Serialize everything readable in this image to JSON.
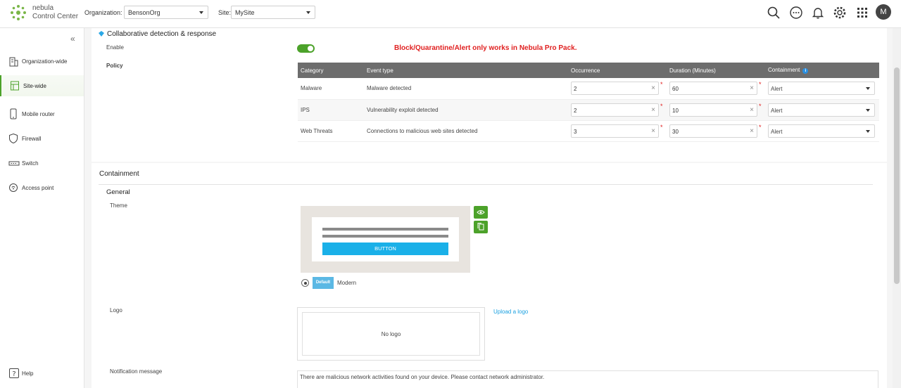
{
  "header": {
    "brand_line1": "nebula",
    "brand_line2": "Control Center",
    "org_label": "Organization:",
    "org_value": "BensonOrg",
    "site_label": "Site:",
    "site_value": "MySite",
    "avatar_letter": "M"
  },
  "sidebar": {
    "items": [
      {
        "label": "Organization-wide"
      },
      {
        "label": "Site-wide"
      },
      {
        "label": "Mobile router"
      },
      {
        "label": "Firewall"
      },
      {
        "label": "Switch"
      },
      {
        "label": "Access point"
      }
    ],
    "help": "Help"
  },
  "cdr": {
    "title": "Collaborative detection & response",
    "enable_label": "Enable",
    "policy_label": "Policy",
    "warning": "Block/Quarantine/Alert only works in Nebula Pro Pack.",
    "columns": [
      "Category",
      "Event type",
      "Occurrence",
      "Duration (Minutes)",
      "Containment"
    ],
    "rows": [
      {
        "category": "Malware",
        "event": "Malware detected",
        "occurrence": "2",
        "duration": "60",
        "containment": "Alert"
      },
      {
        "category": "IPS",
        "event": "Vulnerability exploit detected",
        "occurrence": "2",
        "duration": "10",
        "containment": "Alert"
      },
      {
        "category": "Web Threats",
        "event": "Connections to malicious web sites detected",
        "occurrence": "3",
        "duration": "30",
        "containment": "Alert"
      }
    ]
  },
  "containment": {
    "title": "Containment",
    "general": "General",
    "theme_label": "Theme",
    "preview_button": "BUTTON",
    "default_badge": "Default",
    "theme_name": "Modern",
    "logo_label": "Logo",
    "no_logo": "No logo",
    "upload_link": "Upload a logo",
    "notification_label": "Notification message",
    "notification_text": "There are malicious network activities found on your device. Please contact network administrator."
  },
  "colors": {
    "accent": "#4ca22a",
    "warning": "#e02020",
    "link": "#1aa0e0"
  }
}
